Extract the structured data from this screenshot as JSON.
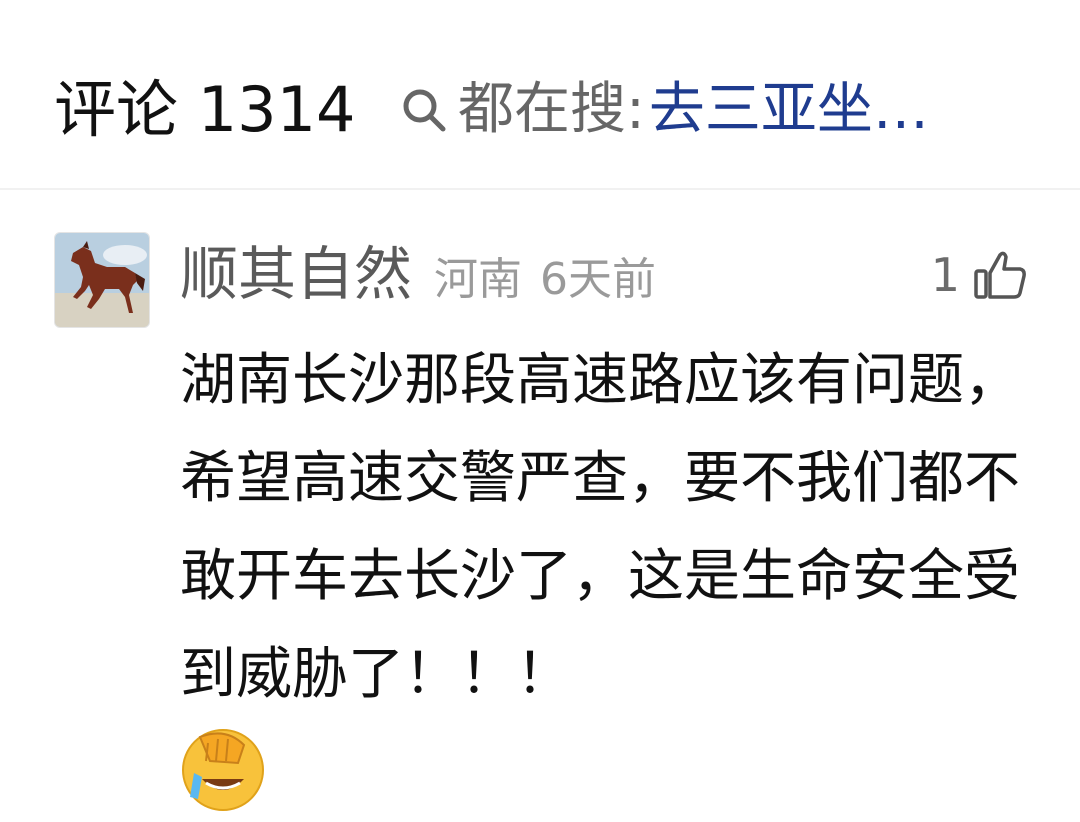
{
  "header": {
    "comments_label": "评论 1314",
    "search_label": "都在搜:",
    "search_term": "去三亚坐",
    "ellipsis": "…"
  },
  "comment": {
    "username": "顺其自然",
    "location": "河南",
    "time": "6天前",
    "likes": "1",
    "text": "湖南长沙那段高速路应该有问题，希望高速交警严查，要不我们都不敢开车去长沙了，这是生命安全受到威胁了！！！",
    "avatar": "horse-avatar",
    "emoji": "facepalm-laugh-emoji"
  },
  "colors": {
    "search_term": "#1f3c8f",
    "muted": "#9a9a9a",
    "username": "#5a5a5a"
  }
}
